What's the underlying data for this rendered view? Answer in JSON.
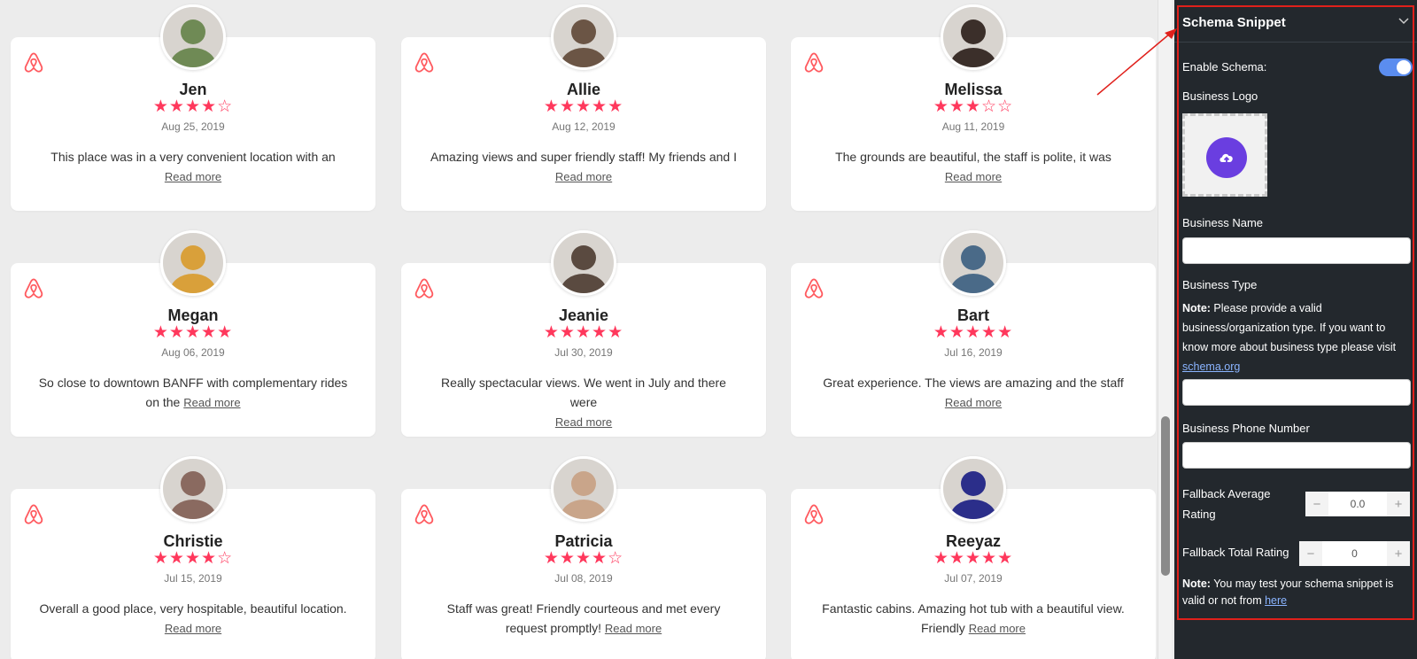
{
  "reviews": [
    {
      "name": "Jen",
      "rating": 4,
      "date": "Aug 25, 2019",
      "text": "This place was in a very convenient location with an",
      "read_more": "Read more",
      "avatar_color": "#6f8a55"
    },
    {
      "name": "Allie",
      "rating": 5,
      "date": "Aug 12, 2019",
      "text": "Amazing views and super friendly staff! My friends and I",
      "read_more": "Read more",
      "avatar_color": "#6b5545"
    },
    {
      "name": "Melissa",
      "rating": 3,
      "date": "Aug 11, 2019",
      "text": "The grounds are beautiful, the staff is polite, it was",
      "read_more": "Read more",
      "avatar_color": "#3b2f2a"
    },
    {
      "name": "Megan",
      "rating": 5,
      "date": "Aug 06, 2019",
      "text": "So close to downtown BANFF with complementary rides on the",
      "read_more": "Read more",
      "avatar_color": "#d9a03a"
    },
    {
      "name": "Jeanie",
      "rating": 5,
      "date": "Jul 30, 2019",
      "text": "Really spectacular views. We went in July and there were",
      "read_more": "Read more",
      "avatar_color": "#5a4a40"
    },
    {
      "name": "Bart",
      "rating": 5,
      "date": "Jul 16, 2019",
      "text": "Great experience. The views are amazing and the staff",
      "read_more": "Read more",
      "avatar_color": "#4a6a88"
    },
    {
      "name": "Christie",
      "rating": 4,
      "date": "Jul 15, 2019",
      "text": "Overall a good place, very hospitable, beautiful location.",
      "read_more": "Read more",
      "avatar_color": "#8a6a60"
    },
    {
      "name": "Patricia",
      "rating": 4,
      "date": "Jul 08, 2019",
      "text": "Staff was great! Friendly courteous and met every request promptly!",
      "read_more": "Read more",
      "avatar_color": "#c9a58a"
    },
    {
      "name": "Reeyaz",
      "rating": 5,
      "date": "Jul 07, 2019",
      "text": "Fantastic cabins. Amazing hot tub with a beautiful view. Friendly",
      "read_more": "Read more",
      "avatar_color": "#2b2e8a"
    }
  ],
  "colors": {
    "star": "#ff385c",
    "airbnb": "#ff5a5f",
    "toggle": "#5b8def",
    "upload": "#6a3ee0",
    "panel_bg": "#23282d",
    "outline": "#e0201b"
  },
  "panel": {
    "title": "Schema Snippet",
    "enable_schema_label": "Enable Schema:",
    "enable_schema_on": true,
    "business_logo_label": "Business Logo",
    "business_name_label": "Business Name",
    "business_name_value": "",
    "business_type_label": "Business Type",
    "business_type_note_bold": "Note:",
    "business_type_note": " Please provide a valid business/organization type. If you want to know more about business type please visit ",
    "business_type_link": "schema.org",
    "business_type_value": "",
    "phone_label": "Business Phone Number",
    "phone_value": "",
    "fallback_avg_label": "Fallback Average Rating",
    "fallback_avg_value": "0.0",
    "fallback_total_label": "Fallback Total Rating",
    "fallback_total_value": "0",
    "stepper_minus": "−",
    "stepper_plus": "+",
    "bottom_note_bold": "Note:",
    "bottom_note": " You may test your schema snippet is valid or not from ",
    "bottom_note_link": "here"
  }
}
